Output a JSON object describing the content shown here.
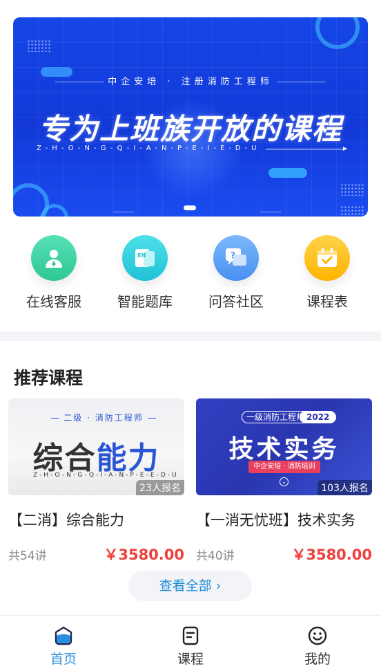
{
  "banner": {
    "subtitle": "中企安培 · 注册消防工程师",
    "title": "专为上班族开放的课程",
    "pinyin": "Z-H-O-N-G-Q-I-A-N-P-E-I-E-D-U"
  },
  "entries": [
    {
      "label": "在线客服",
      "icon": "customer-service-icon",
      "color": "#3fd4a6"
    },
    {
      "label": "智能题库",
      "icon": "question-bank-icon",
      "color": "#34d3e0"
    },
    {
      "label": "问答社区",
      "icon": "qa-community-icon",
      "color": "#5aa3f7"
    },
    {
      "label": "课程表",
      "icon": "calendar-icon",
      "color": "#ffc21e"
    }
  ],
  "section": {
    "title": "推荐课程"
  },
  "courses": [
    {
      "thumb_tag": "二级 · 消防工程师",
      "thumb_title_a": "综合",
      "thumb_title_b": "能力",
      "thumb_pinyin": "Z-H-O-N-G-Q-I-A-N-P-E-E-D-U",
      "enroll": "23人报名",
      "name": "【二消】综合能力",
      "lessons": "共54讲",
      "price": "￥3580.00"
    },
    {
      "thumb_tag": "一级消防工程师",
      "thumb_year": "2022",
      "thumb_title": "技术实务",
      "thumb_pill": "中企安培 · 消防培训",
      "enroll": "103人报名",
      "name": "【一消无忧班】技术实务",
      "lessons": "共40讲",
      "price": "￥3580.00"
    }
  ],
  "view_all": "查看全部",
  "tabs": [
    {
      "label": "首页",
      "active": true
    },
    {
      "label": "课程",
      "active": false
    },
    {
      "label": "我的",
      "active": false
    }
  ],
  "colors": {
    "accent": "#2a8ee0",
    "price": "#f0403d",
    "banner": "#1546e6"
  }
}
